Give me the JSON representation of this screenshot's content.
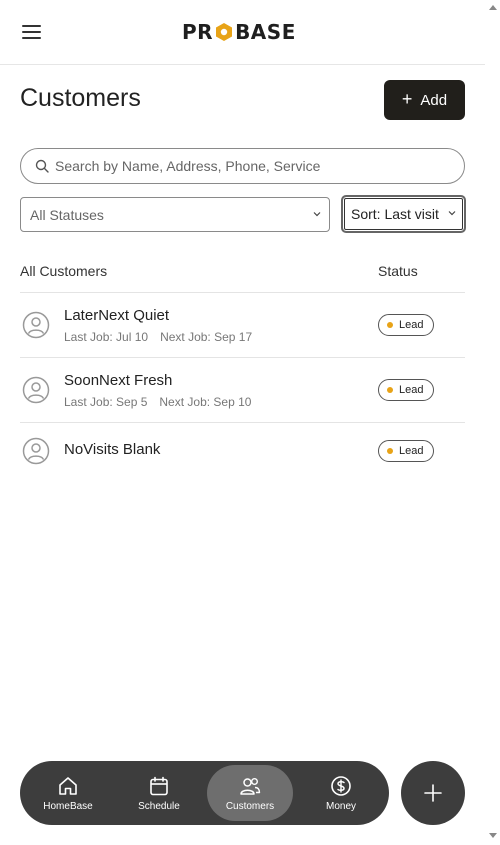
{
  "header": {
    "logo_text_left": "PR",
    "logo_text_right": "BASE",
    "brand_color": "#e8a317"
  },
  "page": {
    "title": "Customers",
    "add_label": "Add"
  },
  "search": {
    "placeholder": "Search by Name, Address, Phone, Service",
    "value": ""
  },
  "filters": {
    "status_value": "All Statuses",
    "sort_value": "Sort: Last visit"
  },
  "list": {
    "header_name": "All Customers",
    "header_status": "Status",
    "rows": [
      {
        "name": "LaterNext Quiet",
        "last_job": "Last Job: Jul 10",
        "next_job": "Next Job: Sep 17",
        "status": "Lead"
      },
      {
        "name": "SoonNext Fresh",
        "last_job": "Last Job: Sep 5",
        "next_job": "Next Job: Sep 10",
        "status": "Lead"
      },
      {
        "name": "NoVisits Blank",
        "last_job": "",
        "next_job": "",
        "status": "Lead"
      }
    ]
  },
  "nav": {
    "items": [
      {
        "label": "HomeBase",
        "icon": "home-icon"
      },
      {
        "label": "Schedule",
        "icon": "calendar-icon"
      },
      {
        "label": "Customers",
        "icon": "users-icon",
        "active": true
      },
      {
        "label": "Money",
        "icon": "dollar-icon"
      }
    ],
    "fab_icon": "plus-icon"
  }
}
